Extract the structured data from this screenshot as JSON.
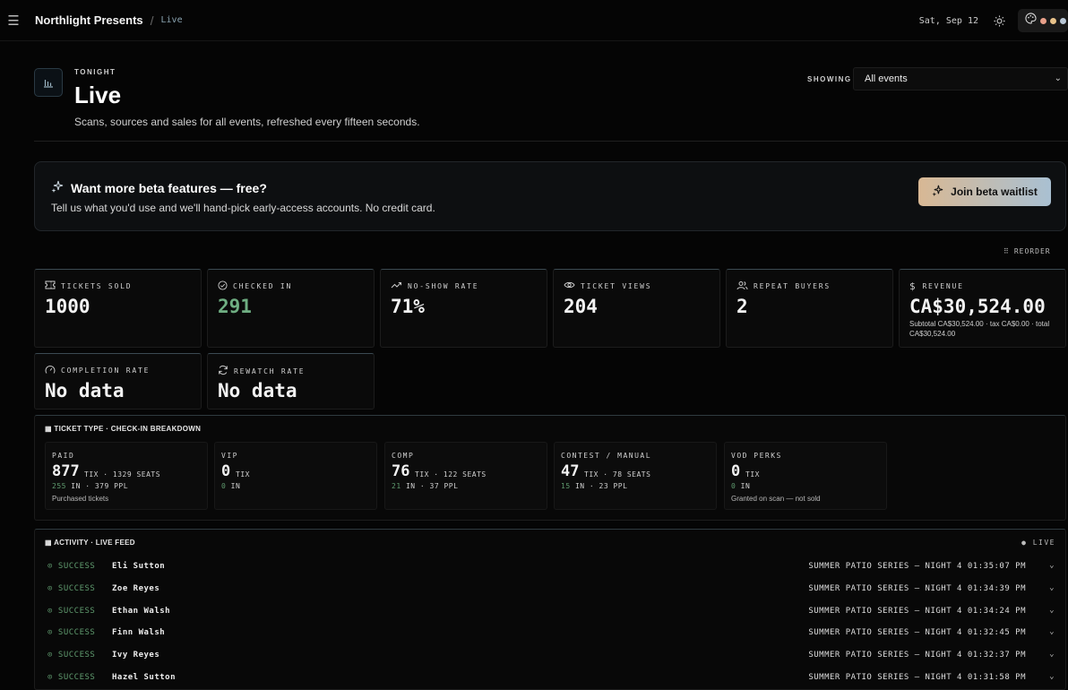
{
  "topbar": {
    "brand": "Northlight Presents",
    "separator": "/",
    "crumb": "Live",
    "date": "Sat, Sep 12"
  },
  "header": {
    "eyebrow": "TONIGHT",
    "title": "Live",
    "subtitle": "Scans, sources and sales for all events, refreshed every fifteen seconds.",
    "showing_label": "SHOWING",
    "showing_value": "All events"
  },
  "beta": {
    "title": "Want more beta features — free?",
    "text": "Tell us what you'd use and we'll hand-pick early-access accounts. No credit card.",
    "button": "Join beta waitlist"
  },
  "reorder_label": "REORDER",
  "stats": [
    {
      "label": "TICKETS SOLD",
      "value": "1000",
      "icon": "ticket-icon"
    },
    {
      "label": "CHECKED IN",
      "value": "291",
      "icon": "check-circle-icon",
      "color": "#6fae82"
    },
    {
      "label": "NO-SHOW RATE",
      "value": "71%",
      "icon": "trend-icon"
    },
    {
      "label": "TICKET VIEWS",
      "value": "204",
      "icon": "eye-icon"
    },
    {
      "label": "REPEAT BUYERS",
      "value": "2",
      "icon": "users-icon"
    },
    {
      "label": "REVENUE",
      "value": "CA$30,524.00",
      "icon": "dollar-icon",
      "sub": "Subtotal CA$30,524.00 · tax CA$0.00 · total CA$30,524.00"
    },
    {
      "label": "COMPLETION RATE",
      "value": "No data",
      "icon": "gauge-icon"
    },
    {
      "label": "REWATCH RATE",
      "value": "No data",
      "icon": "refresh-icon"
    }
  ],
  "breakdown": {
    "title": "TICKET TYPE · CHECK-IN BREAKDOWN",
    "items": [
      {
        "name": "PAID",
        "value": "877",
        "unit": "TIX · 1329 SEATS",
        "in_count": "255",
        "in_rest": " IN · 379 PPL",
        "note": "Purchased tickets"
      },
      {
        "name": "VIP",
        "value": "0",
        "unit": "TIX",
        "in_count": "0",
        "in_rest": " IN",
        "note": ""
      },
      {
        "name": "COMP",
        "value": "76",
        "unit": "TIX · 122 SEATS",
        "in_count": "21",
        "in_rest": " IN · 37 PPL",
        "note": ""
      },
      {
        "name": "CONTEST / MANUAL",
        "value": "47",
        "unit": "TIX · 78 SEATS",
        "in_count": "15",
        "in_rest": " IN · 23 PPL",
        "note": ""
      },
      {
        "name": "VOD PERKS",
        "value": "0",
        "unit": "TIX",
        "in_count": "0",
        "in_rest": " IN",
        "note": "Granted on scan — not sold"
      }
    ]
  },
  "activity": {
    "title": "ACTIVITY · LIVE FEED",
    "live": "● LIVE",
    "rows": [
      {
        "status": "SUCCESS",
        "name": "Eli Sutton",
        "event": "SUMMER PATIO SERIES — NIGHT 4",
        "time": "01:35:07 PM"
      },
      {
        "status": "SUCCESS",
        "name": "Zoe Reyes",
        "event": "SUMMER PATIO SERIES — NIGHT 4",
        "time": "01:34:39 PM"
      },
      {
        "status": "SUCCESS",
        "name": "Ethan Walsh",
        "event": "SUMMER PATIO SERIES — NIGHT 4",
        "time": "01:34:24 PM"
      },
      {
        "status": "SUCCESS",
        "name": "Finn Walsh",
        "event": "SUMMER PATIO SERIES — NIGHT 4",
        "time": "01:32:45 PM"
      },
      {
        "status": "SUCCESS",
        "name": "Ivy Reyes",
        "event": "SUMMER PATIO SERIES — NIGHT 4",
        "time": "01:32:37 PM"
      },
      {
        "status": "SUCCESS",
        "name": "Hazel Sutton",
        "event": "SUMMER PATIO SERIES — NIGHT 4",
        "time": "01:31:58 PM"
      }
    ]
  },
  "colors": {
    "accent_green": "#5f9a6e",
    "theme_dots": [
      "#e8a08a",
      "#e8c28a",
      "#b9c7d6"
    ]
  }
}
